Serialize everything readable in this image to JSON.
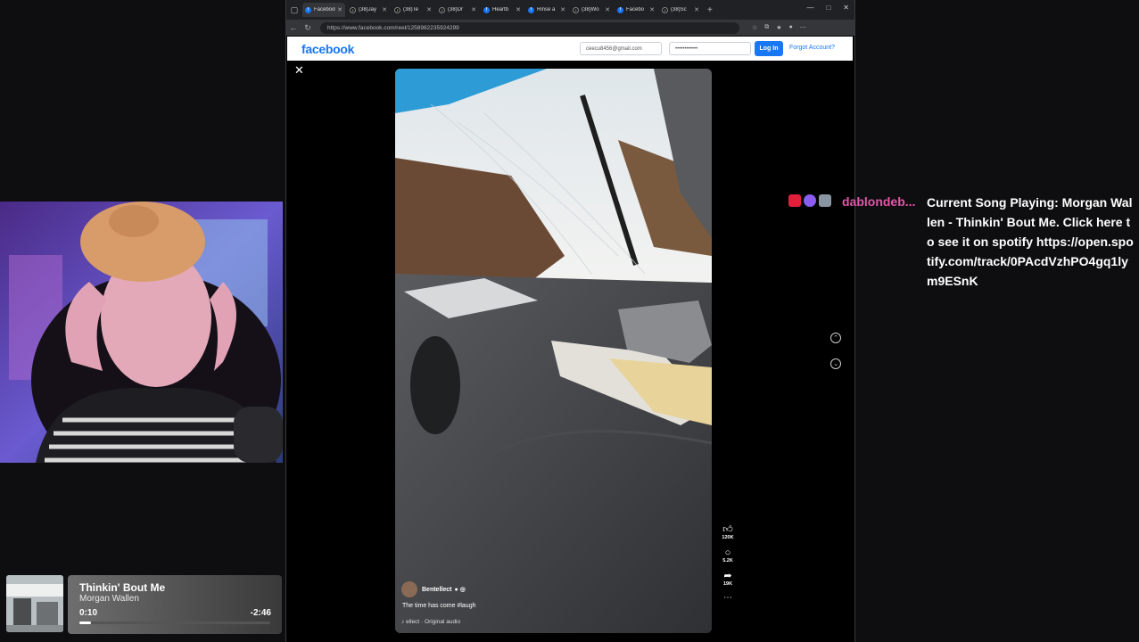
{
  "browser": {
    "tabs": [
      {
        "label": "Facebook",
        "icon": "facebook-icon",
        "active": true
      },
      {
        "label": "(38)Jay",
        "icon": "tiktok-icon"
      },
      {
        "label": "(38)Te",
        "icon": "tiktok-icon"
      },
      {
        "label": "(38)Dr",
        "icon": "tiktok-icon"
      },
      {
        "label": "Heartb",
        "icon": "facebook-icon"
      },
      {
        "label": "Rinse a",
        "icon": "facebook-icon"
      },
      {
        "label": "(38)Wo",
        "icon": "tiktok-icon"
      },
      {
        "label": "Facebo",
        "icon": "facebook-icon"
      },
      {
        "label": "(38)Sc",
        "icon": "tiktok-icon"
      }
    ],
    "url": "https://www.facebook.com/reel/1258982235924299"
  },
  "facebook": {
    "logo": "facebook",
    "email_value": "ceecu8456@gmail.com",
    "password_value": "••••••••••••",
    "login_label": "Log In",
    "forgot_label": "Forgot Account?"
  },
  "reel": {
    "likes": "120K",
    "comments": "5.2K",
    "shares": "19K",
    "author": "Bentellect",
    "description": "The time has come #laugh",
    "audio": "ellect · Original audio"
  },
  "chat": {
    "username": "dablondeb...",
    "message": "Current Song Playing: Morgan Wallen - Thinkin' Bout Me. Click here to see it on spotify https://open.spotify.com/track/0PAcdVzhPO4gq1lym9ESnK"
  },
  "now_playing": {
    "title": "Thinkin' Bout Me",
    "artist": "Morgan Wallen",
    "elapsed": "0:10",
    "remaining": "-2:46",
    "progress": 0.06
  },
  "colors": {
    "facebook_blue": "#1877f2",
    "chat_username": "#e256a8",
    "background": "#0e0e10"
  }
}
